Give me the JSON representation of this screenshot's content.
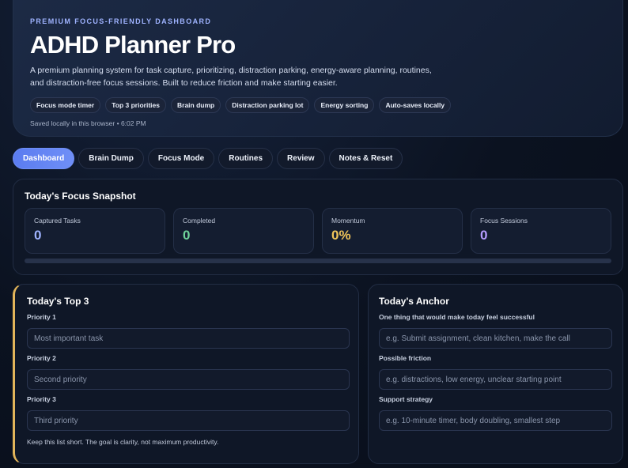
{
  "hero": {
    "eyebrow": "PREMIUM FOCUS-FRIENDLY DASHBOARD",
    "title": "ADHD Planner Pro",
    "description": "A premium planning system for task capture, prioritizing, distraction parking, energy-aware planning, routines, and distraction-free focus sessions. Built to reduce friction and make starting easier.",
    "chips": [
      "Focus mode timer",
      "Top 3 priorities",
      "Brain dump",
      "Distraction parking lot",
      "Energy sorting",
      "Auto-saves locally"
    ],
    "saved_status": "Saved locally in this browser • 6:02 PM"
  },
  "tabs": [
    "Dashboard",
    "Brain Dump",
    "Focus Mode",
    "Routines",
    "Review",
    "Notes & Reset"
  ],
  "active_tab": "Dashboard",
  "snapshot": {
    "title": "Today's Focus Snapshot",
    "stats": [
      {
        "label": "Captured Tasks",
        "value": "0",
        "color": "#9fb3ff"
      },
      {
        "label": "Completed",
        "value": "0",
        "color": "#6fd39a"
      },
      {
        "label": "Momentum",
        "value": "0%",
        "color": "#f0c45a"
      },
      {
        "label": "Focus Sessions",
        "value": "0",
        "color": "#b59cff"
      }
    ],
    "progress_fraction": 0
  },
  "top3": {
    "title": "Today's Top 3",
    "fields": [
      {
        "label": "Priority 1",
        "placeholder": "Most important task"
      },
      {
        "label": "Priority 2",
        "placeholder": "Second priority"
      },
      {
        "label": "Priority 3",
        "placeholder": "Third priority"
      }
    ],
    "hint": "Keep this list short. The goal is clarity, not maximum productivity."
  },
  "anchor": {
    "title": "Today's Anchor",
    "fields": [
      {
        "label": "One thing that would make today feel successful",
        "placeholder": "e.g. Submit assignment, clean kitchen, make the call"
      },
      {
        "label": "Possible friction",
        "placeholder": "e.g. distractions, low energy, unclear starting point"
      },
      {
        "label": "Support strategy",
        "placeholder": "e.g. 10-minute timer, body doubling, smallest step"
      }
    ]
  },
  "colors": {
    "accent": "#5b7cf0",
    "top3_border": "#e3b55a"
  }
}
